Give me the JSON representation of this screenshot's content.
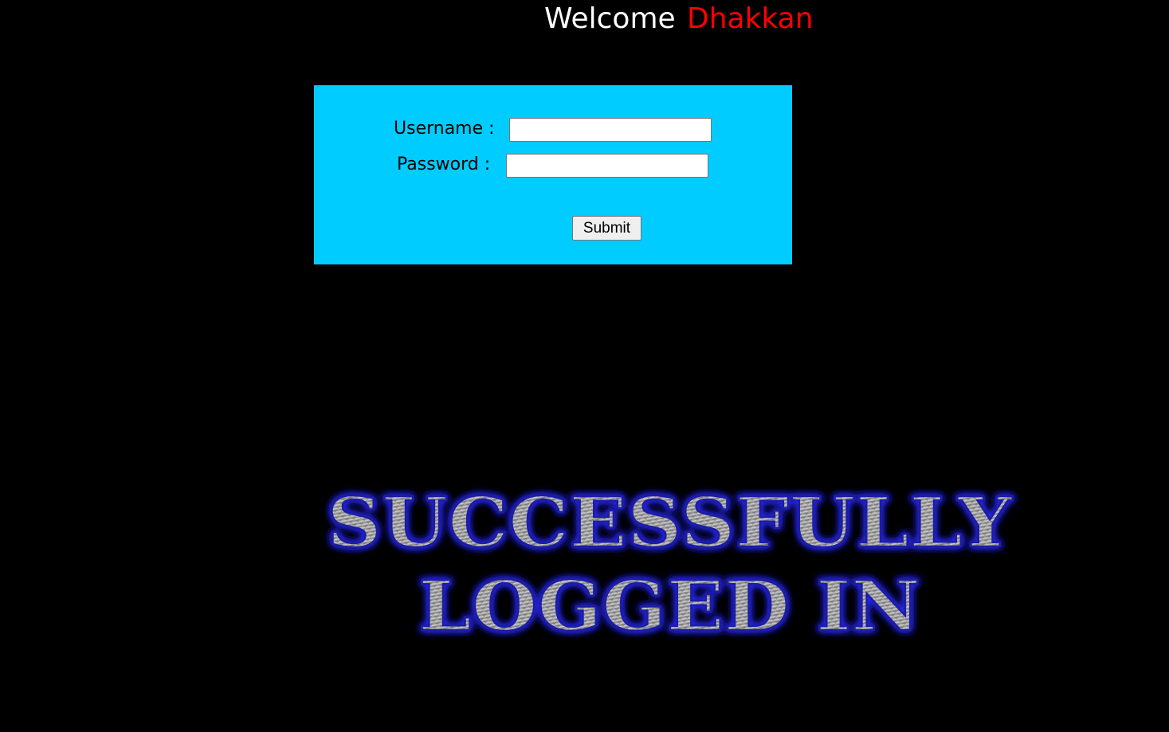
{
  "header": {
    "welcome_text": "Welcome",
    "user_name": "Dhakkan"
  },
  "login_form": {
    "username_label": "Username :",
    "username_value": "",
    "password_label": "Password :",
    "password_value": "",
    "submit_label": "Submit"
  },
  "banner": {
    "line1": "SUCCESSFULLY",
    "line2": "LOGGED IN"
  },
  "colors": {
    "background": "#000000",
    "form_background": "#00ccff",
    "welcome_text": "#ffffff",
    "user_name": "#ff0000",
    "banner_glow": "#2a2aff"
  }
}
